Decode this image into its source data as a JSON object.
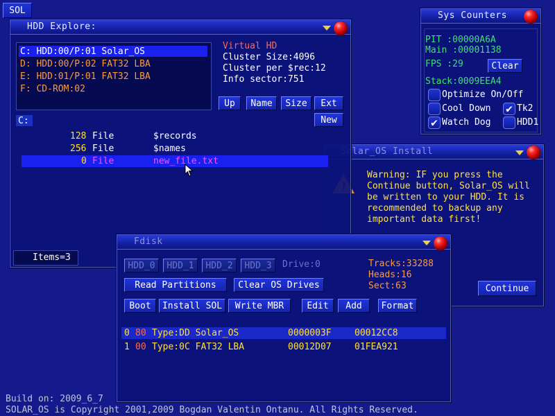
{
  "taskbar": {
    "sol_label": "SOL"
  },
  "footer": {
    "build": "Build on: 2009_6_7",
    "copyright": "SOLAR_OS is Copyright 2001,2009 Bogdan Valentin Ontanu. All Rights Reserved."
  },
  "hdd_explorer": {
    "title": "HDD Explore:",
    "drives": [
      {
        "text": "C: HDD:00/P:01 Solar_OS"
      },
      {
        "text": "D: HDD:00/P:02 FAT32 LBA"
      },
      {
        "text": "E: HDD:01/P:01 FAT32 LBA"
      },
      {
        "text": "F: CD-ROM:02"
      }
    ],
    "info": {
      "virtual": "Virtual HD",
      "cluster_size": "Cluster Size:4096",
      "cluster_per_rec": "Cluster per $rec:12",
      "info_sector": "Info sector:751"
    },
    "buttons": {
      "up": "Up",
      "name": "Name",
      "size": "Size",
      "ext": "Ext",
      "new": "New"
    },
    "path": "C:",
    "files": [
      {
        "size": "128",
        "type": "File",
        "name": "$records"
      },
      {
        "size": "256",
        "type": "File",
        "name": "$names"
      },
      {
        "size": "0",
        "type": "File",
        "name": "new_file.txt"
      }
    ],
    "status": "Items=3"
  },
  "sys_counters": {
    "title": "Sys Counters",
    "pit": "PIT  :00000A6A",
    "main": "Main :00001138",
    "fps": "FPS  :29",
    "clear": "Clear",
    "stack": "Stack:0009EEA4",
    "checks": {
      "optimize": "Optimize On/Off",
      "cool_down": "Cool Down",
      "tk2": "Tk2",
      "watch_dog": "Watch Dog",
      "hdd1": "HDD1"
    }
  },
  "install": {
    "title": "Solar_OS Install",
    "warning": [
      "Warning: IF you press the",
      "Continue button, Solar_OS will",
      "be written to your HDD. It is",
      "recommended to backup any",
      "important data first!"
    ],
    "continue": "Continue"
  },
  "fdisk": {
    "title": "Fdisk",
    "hdd_tabs": [
      "HDD_0",
      "HDD_1",
      "HDD_2",
      "HDD_3"
    ],
    "drive": "Drive:0",
    "tracks": "Tracks:33288",
    "heads": "Heads:16",
    "sect": "Sect:63",
    "buttons": {
      "read": "Read Partitions",
      "clear": "Clear OS Drives",
      "boot": "Boot",
      "install": "Install SOL",
      "write": "Write MBR",
      "edit": "Edit",
      "add": "Add",
      "format": "Format"
    },
    "partitions": [
      {
        "idx": "0",
        "flag": "80",
        "type": "Type:DD Solar_OS",
        "start": "0000003F",
        "size": "00012CC8"
      },
      {
        "idx": "1",
        "flag": "00",
        "type": "Type:0C FAT32 LBA",
        "start": "00012D07",
        "size": "01FEA921"
      }
    ]
  },
  "colors": {
    "desktop": "#141a8c",
    "title_grad": "#2a3ad8",
    "selection": "#1a20f0"
  }
}
